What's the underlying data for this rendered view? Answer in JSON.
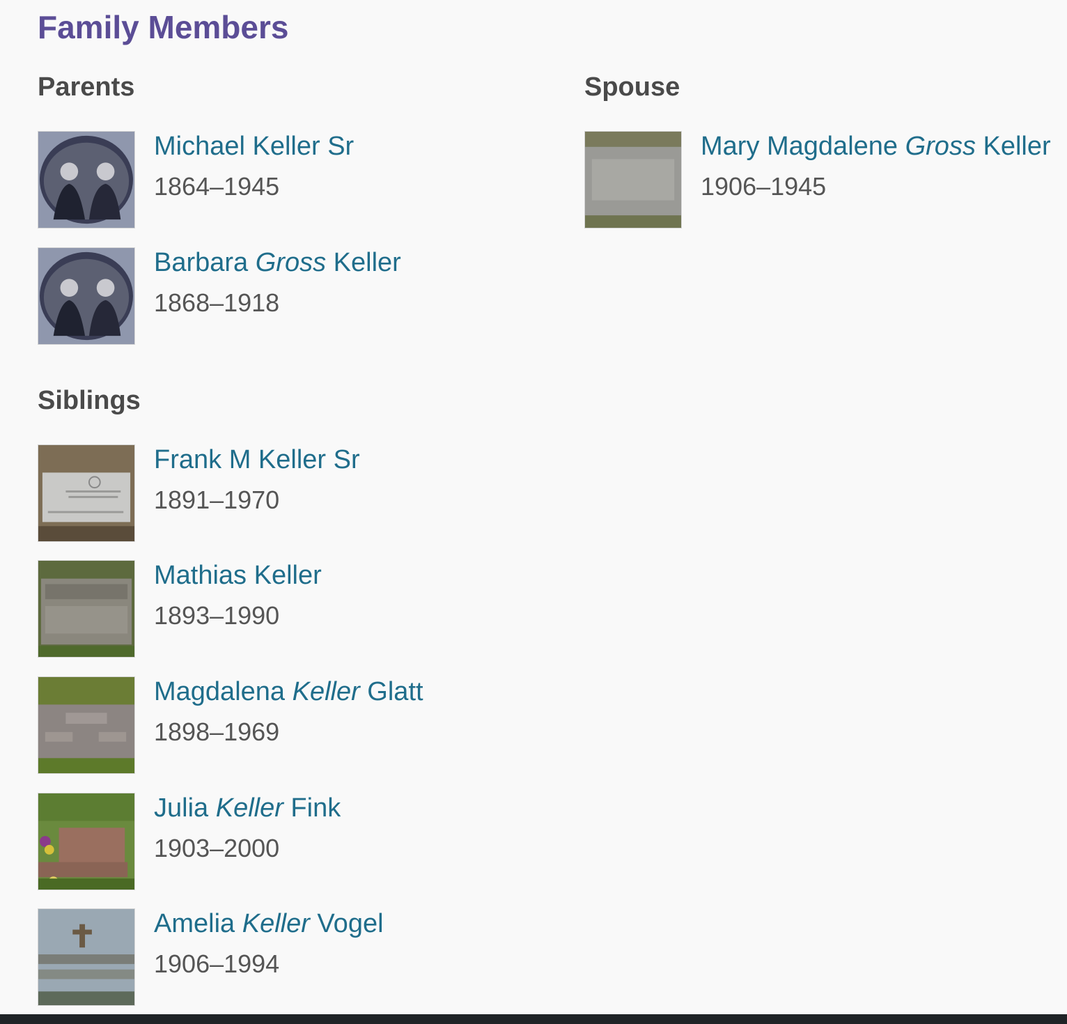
{
  "title": "Family Members",
  "sections": {
    "parents": {
      "heading": "Parents",
      "people": [
        {
          "first": "Michael Keller Sr",
          "maiden": "",
          "last": "",
          "years": "1864–1945",
          "photo": "oval-couple-portrait"
        },
        {
          "first": "Barbara ",
          "maiden": "Gross",
          "last": " Keller",
          "years": "1868–1918",
          "photo": "oval-couple-portrait"
        }
      ]
    },
    "spouse": {
      "heading": "Spouse",
      "people": [
        {
          "first": "Mary Magdalene ",
          "maiden": "Gross",
          "last": " Keller",
          "years": "1906–1945",
          "photo": "flat-grave-marker"
        }
      ]
    },
    "siblings": {
      "heading": "Siblings",
      "people": [
        {
          "first": "Frank M Keller Sr",
          "maiden": "",
          "last": "",
          "years": "1891–1970",
          "photo": "military-headstone"
        },
        {
          "first": "Mathias Keller",
          "maiden": "",
          "last": "",
          "years": "1893–1990",
          "photo": "flat-grave-marker"
        },
        {
          "first": "Magdalena ",
          "maiden": "Keller",
          "last": " Glatt",
          "years": "1898–1969",
          "photo": "headstone-on-grass"
        },
        {
          "first": "Julia ",
          "maiden": "Keller",
          "last": " Fink",
          "years": "1903–2000",
          "photo": "headstone-with-flowers"
        },
        {
          "first": "Amelia ",
          "maiden": "Keller",
          "last": " Vogel",
          "years": "1906–1994",
          "photo": "double-headstone"
        }
      ]
    }
  },
  "colors": {
    "title": "#5b4d96",
    "link": "#1f6d8b",
    "heading": "#4a4a4a",
    "years": "#555555"
  }
}
